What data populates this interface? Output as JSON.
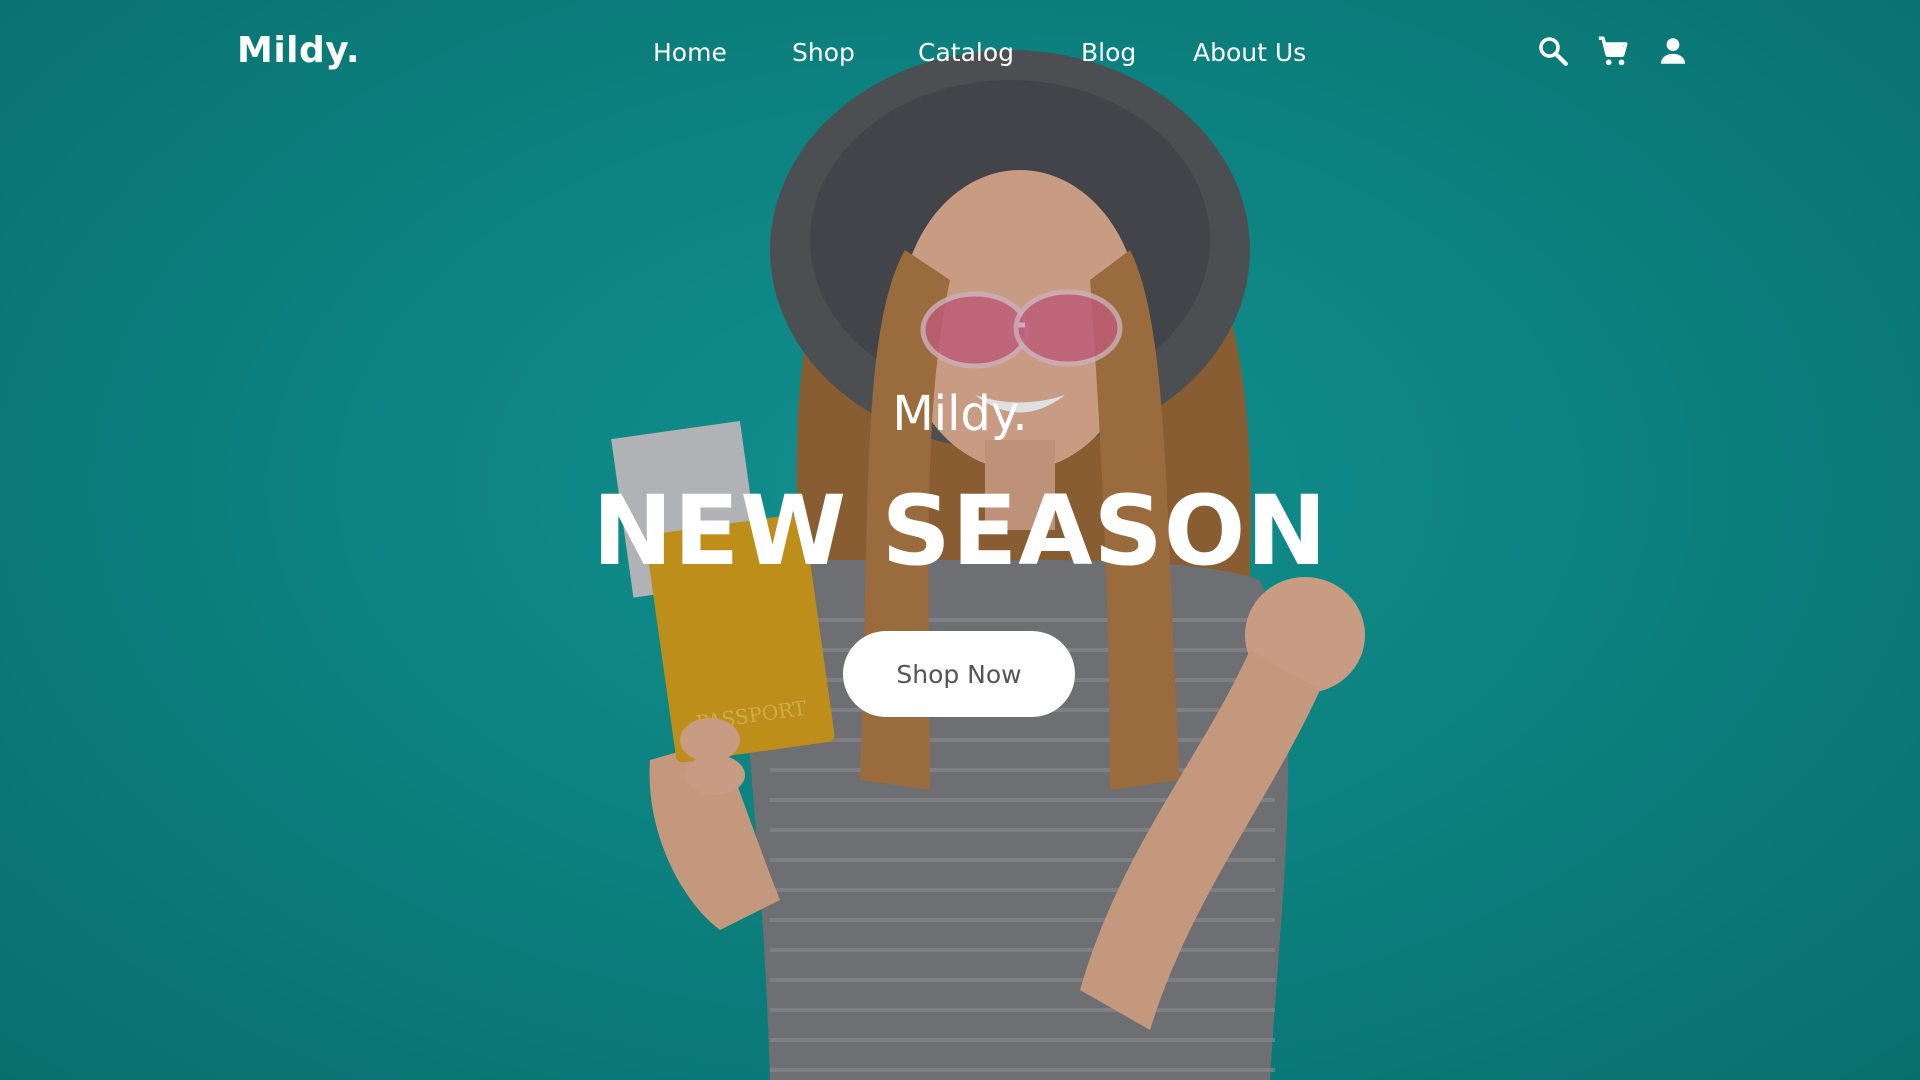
{
  "header": {
    "logo": "Mildy.",
    "nav": [
      {
        "label": "Home"
      },
      {
        "label": "Shop"
      },
      {
        "label": "Catalog"
      },
      {
        "label": "Blog"
      },
      {
        "label": "About Us"
      }
    ],
    "icons": [
      "search-icon",
      "cart-icon",
      "user-icon"
    ]
  },
  "hero": {
    "brand": "Mildy.",
    "headline": "NEW SEASON",
    "cta_label": "Shop Now",
    "passport_text": "PASSPORT"
  },
  "colors": {
    "background": "#12a09e",
    "text": "#ffffff",
    "button_bg": "#ffffff",
    "button_text": "#555555"
  }
}
